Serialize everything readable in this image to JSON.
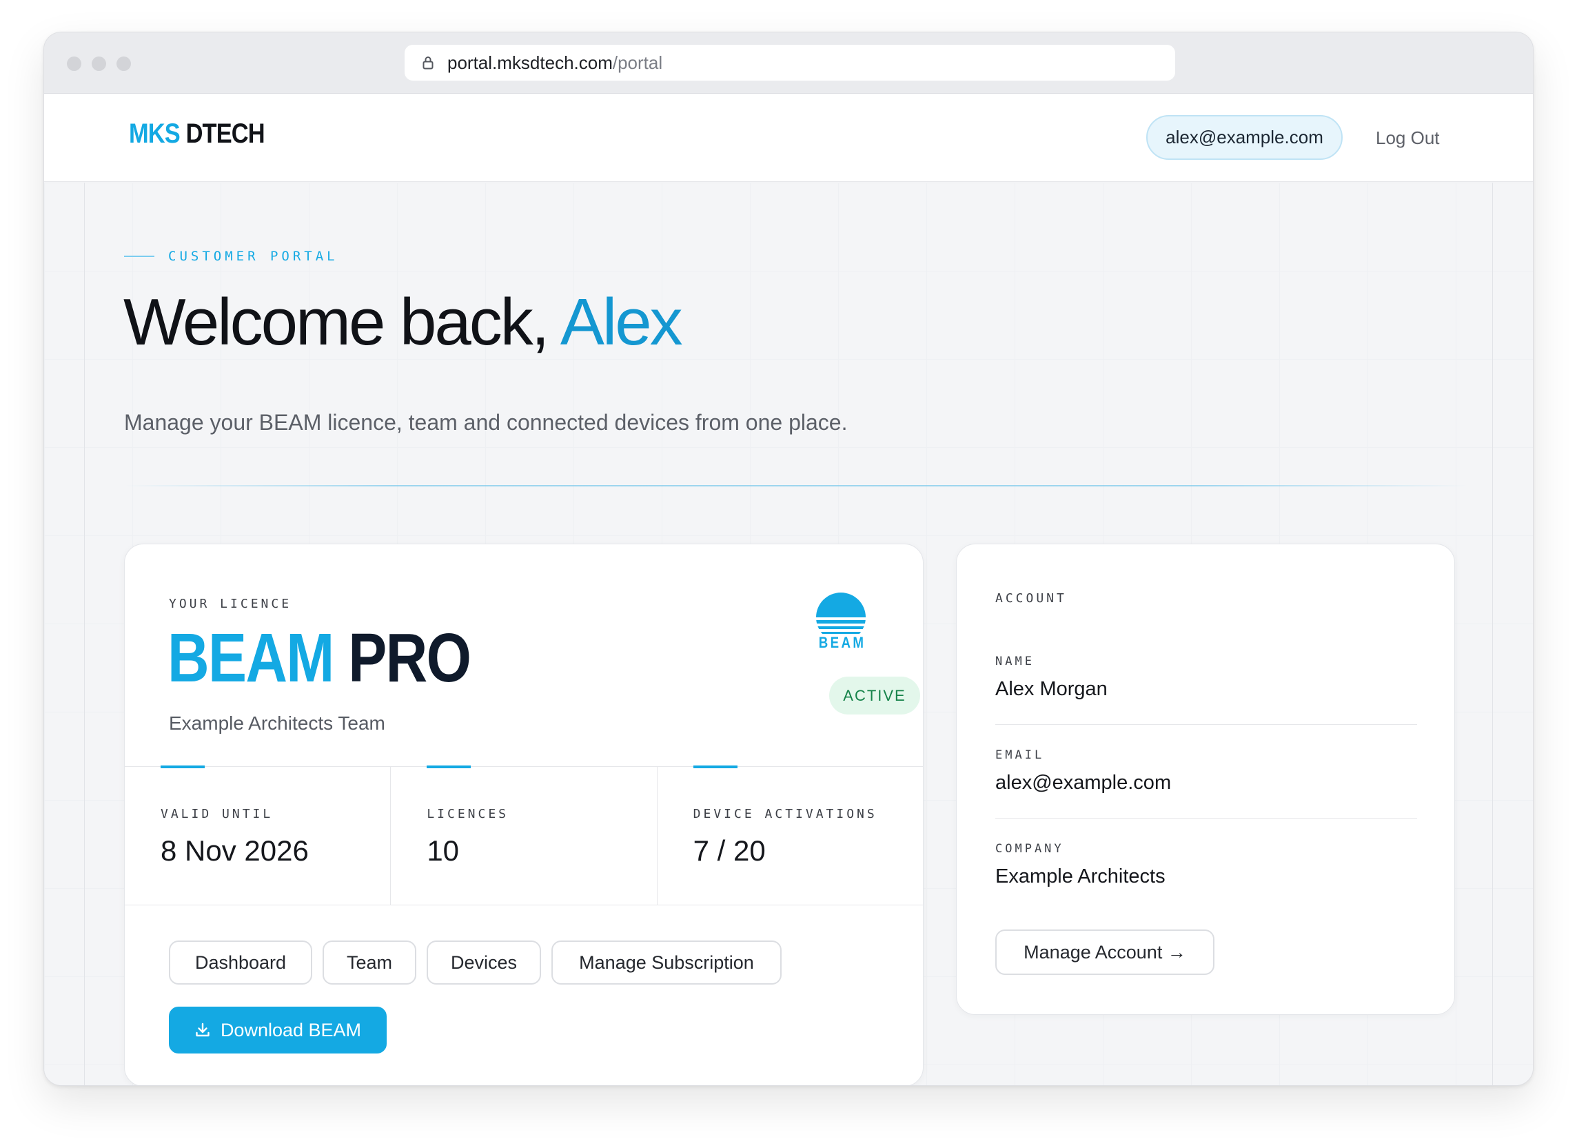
{
  "browser": {
    "url_host": "portal.mksdtech.com",
    "url_path": "/portal"
  },
  "header": {
    "logo_part1": "MKS",
    "logo_part2": "DTECH",
    "user_email": "alex@example.com",
    "logout_label": "Log Out"
  },
  "hero": {
    "eyebrow": "CUSTOMER PORTAL",
    "welcome_prefix": "Welcome back, ",
    "welcome_name": "Alex",
    "subtitle": "Manage your BEAM licence, team and connected devices from one place."
  },
  "licence": {
    "label": "YOUR LICENCE",
    "product_part1": "BEAM",
    "product_part2": "PRO",
    "team_name": "Example Architects Team",
    "logo_text": "BEAM",
    "status": "ACTIVE",
    "stats": [
      {
        "label": "VALID UNTIL",
        "value": "8 Nov 2026"
      },
      {
        "label": "LICENCES",
        "value": "10"
      },
      {
        "label": "DEVICE ACTIVATIONS",
        "value": "7 / 20"
      }
    ],
    "buttons": {
      "dashboard": "Dashboard",
      "team": "Team",
      "devices": "Devices",
      "manage_subscription": "Manage Subscription",
      "download": "Download BEAM"
    }
  },
  "account": {
    "title": "ACCOUNT",
    "name_label": "NAME",
    "name_value": "Alex Morgan",
    "email_label": "EMAIL",
    "email_value": "alex@example.com",
    "company_label": "COMPANY",
    "company_value": "Example Architects",
    "manage_label": "Manage Account →"
  },
  "colors": {
    "accent": "#14a9e3",
    "active_bg": "#e3f7eb",
    "active_text": "#16834a"
  }
}
